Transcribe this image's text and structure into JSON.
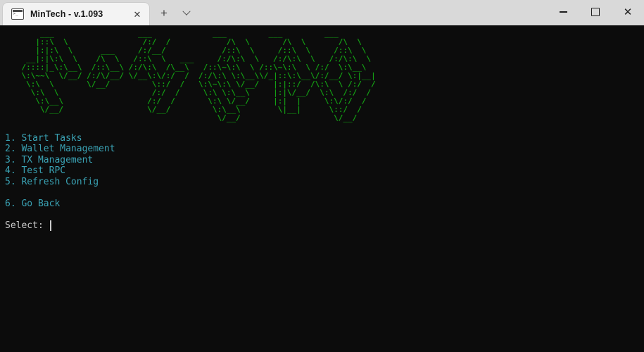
{
  "window": {
    "tab": {
      "title": "MinTech - v.1.093",
      "icon": "terminal-icon",
      "close_label": "✕"
    },
    "new_tab_label": "+",
    "tab_dropdown_label": "",
    "controls": {
      "minimize_label": "",
      "maximize_label": "",
      "close_label": "✕"
    }
  },
  "terminal": {
    "colors": {
      "background": "#0c0c0c",
      "ascii_green": "#16a916",
      "menu_cyan": "#3aa3b5",
      "prompt_white": "#cccccc"
    },
    "banner": "        ___                  ___             ___         ___         ___     \n       |::\\  \\                /:/  /            /\\  \\       /\\  \\       /\\  \\    \n       |:|:\\  \\      ___     /:/__/            /::\\  \\     /::\\  \\     /::\\  \\   \n     __|:|\\:\\  \\    /\\  \\   /::\\  \\   ___     /:/\\:\\  \\   /:/\\:\\  \\   /:/\\:\\  \\  \n    /::::|_\\:\\__\\  /::\\__\\ /:/\\:\\  /\\__\\   /::\\~\\:\\  \\ /::\\~\\:\\  \\ /:/  \\:\\__\\ \n    \\:\\~~\\  \\/__/ /:/\\/__/ \\/__\\:\\/:/  /  /:/\\:\\ \\:\\__\\\\/_|::\\:\\__\\/:/__/ \\:|__|\n     \\:\\  \\       \\/__/         \\::/  /   \\:\\~\\:\\ \\/__/   |:|::/  /\\:\\  \\ /:/  /\n      \\:\\  \\                    /:/  /     \\:\\ \\:\\__\\     |:|\\/__/  \\:\\  /:/  / \n       \\:\\__\\                  /:/  /       \\:\\ \\/__/     |:|  |     \\:\\/:/  /  \n        \\/__/                  \\/__/         \\:\\__\\        \\|__|      \\::/  /   \n                                              \\/__/                    \\/__/    ",
    "menu_items": [
      "1. Start Tasks",
      "2. Wallet Management",
      "3. TX Management",
      "4. Test RPC",
      "5. Refresh Config"
    ],
    "menu_back": "6. Go Back",
    "prompt": "Select: "
  }
}
